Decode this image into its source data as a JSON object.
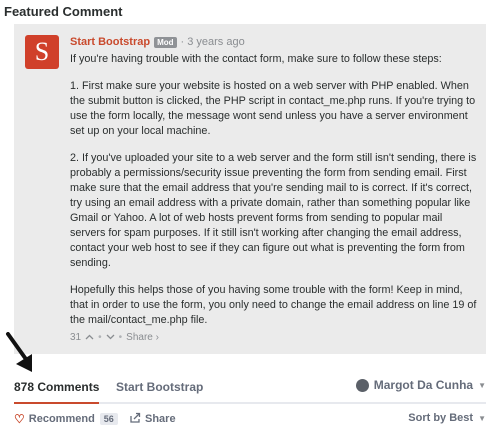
{
  "featured": {
    "title": "Featured Comment"
  },
  "comment": {
    "avatar_letter": "S",
    "author": "Start Bootstrap",
    "badge": "Mod",
    "time": "3 years ago",
    "paragraphs": [
      "If you're having trouble with the contact form, make sure to follow these steps:",
      "1. First make sure your website is hosted on a web server with PHP enabled. When the submit button is clicked, the PHP script in contact_me.php runs. If you're trying to use the form locally, the message wont send unless you have a server environment set up on your local machine.",
      "2. If you've uploaded your site to a web server and the form still isn't sending, there is probably a permissions/security issue preventing the form from sending email. First make sure that the email address that you're sending mail to is correct. If it's correct, try using an email address with a private domain, rather than something popular like Gmail or Yahoo. A lot of web hosts prevent forms from sending to popular mail servers for spam purposes. If it still isn't working after changing the email address, contact your web host to see if they can figure out what is preventing the form from sending.",
      "Hopefully this helps those of you having some trouble with the form! Keep in mind, that in order to use the form, you only need to change the email address on line 19 of the mail/contact_me.php file."
    ],
    "upvotes": "31",
    "share_label": "Share ›"
  },
  "tabs": {
    "comments_label": "878 Comments",
    "site_label": "Start Bootstrap",
    "user_name": "Margot Da Cunha"
  },
  "bottom": {
    "recommend_label": "Recommend",
    "recommend_count": "56",
    "share_label": "Share",
    "sort_label": "Sort by Best"
  },
  "colors": {
    "accent": "#c94a2d",
    "avatar_bg": "#d0402a",
    "box_bg": "#ebebeb"
  }
}
